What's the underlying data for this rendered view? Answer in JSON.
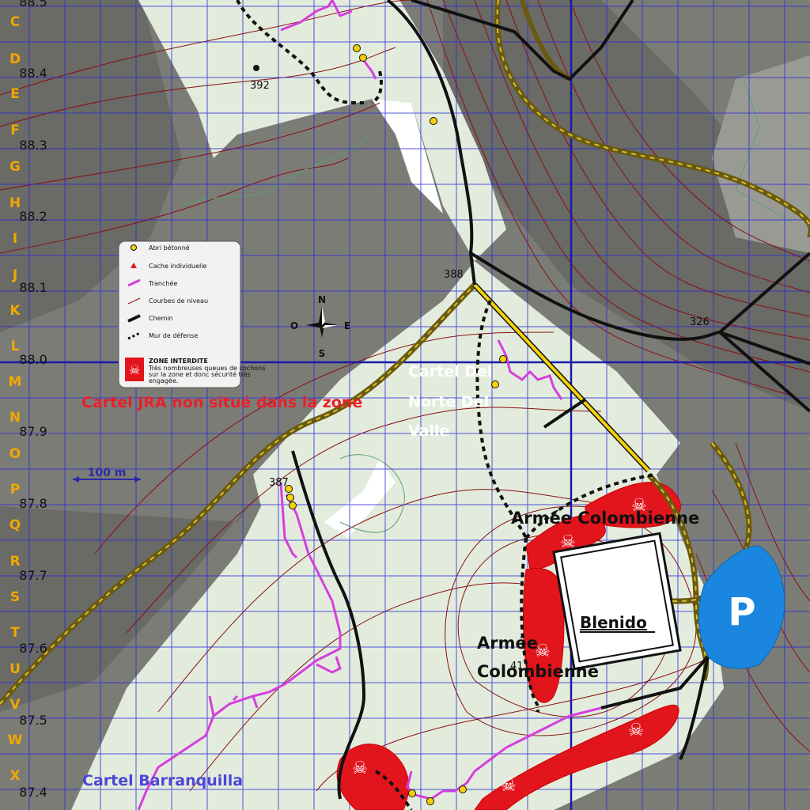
{
  "map": {
    "grid_letters": [
      "C",
      "D",
      "E",
      "F",
      "G",
      "H",
      "I",
      "J",
      "K",
      "L",
      "M",
      "N",
      "O",
      "P",
      "Q",
      "R",
      "S",
      "T",
      "U",
      "V",
      "W",
      "X"
    ],
    "grid_numbers": [
      "88.5",
      "88.4",
      "88.3",
      "88.2",
      "88.1",
      "88.0",
      "87.9",
      "87.8",
      "87.7",
      "87.6",
      "87.5",
      "87.4"
    ],
    "elevations": [
      "392",
      "388",
      "387",
      "326",
      "411"
    ],
    "labels": {
      "cartel_jra": "Cartel JRA non situé dans la zone",
      "cartel_del_norte_1": "Cartel Del",
      "cartel_del_norte_2": "Norte Del",
      "cartel_del_norte_3": "Valle",
      "armee_colombienne_top": "Armée Colombienne",
      "armee_colombienne_mid_1": "Armée",
      "armee_colombienne_mid_2": "Colombienne",
      "blenido": "Blenido",
      "cartel_barranquilla": "Cartel Barranquilla",
      "parking": "P"
    },
    "scale_bar": "100 m",
    "compass": {
      "n": "N",
      "s": "S",
      "e": "E",
      "o": "O"
    },
    "legend": {
      "items": [
        {
          "label": "Abri bétonné",
          "icon": "yellow-dot-icon"
        },
        {
          "label": "Cache individuelle",
          "icon": "red-triangle-icon"
        },
        {
          "label": "Tranchée",
          "icon": "magenta-line-icon"
        },
        {
          "label": "Courbes de niveau",
          "icon": "red-thin-line-icon"
        },
        {
          "label": "Chemin",
          "icon": "black-line-icon"
        },
        {
          "label": "Mur de défense",
          "icon": "dashed-line-icon"
        }
      ],
      "zone_title": "ZONE  INTERDITE",
      "zone_text_1": "Très nombreuses queues de cochons",
      "zone_text_2": "sur la zone et donc sécurité très",
      "zone_text_3": "engagée."
    },
    "colors": {
      "terrain_light": "#e3ecdc",
      "terrain_dark": "#7d7d78",
      "grid": "#2a2ad8",
      "forbidden_zone": "#e2141c",
      "trench": "#d63ee0",
      "path_gold": "#8a7a14",
      "parking": "#1a86e0"
    }
  }
}
